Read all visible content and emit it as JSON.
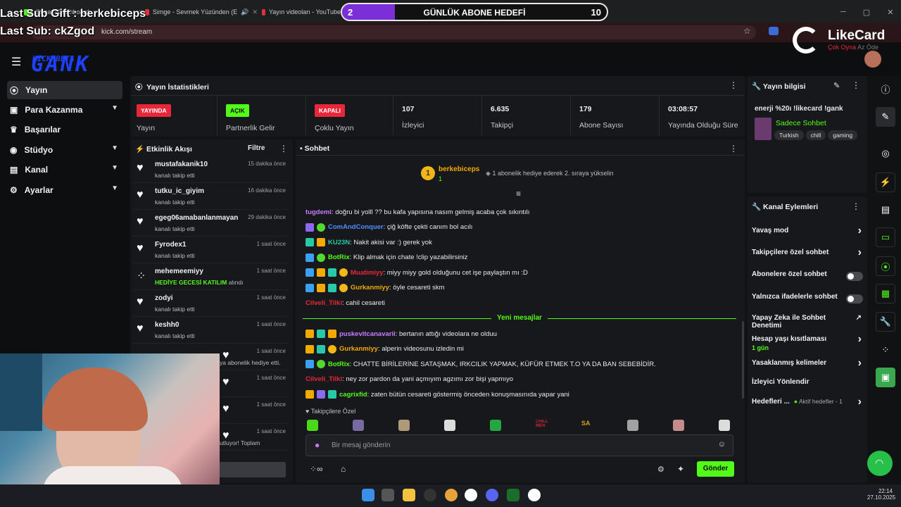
{
  "browser": {
    "tabs": [
      {
        "label": "Stream Dashboard",
        "color": "#53fc18"
      },
      {
        "label": "Simge - Sevmek Yüzünden (E",
        "color": "#e0303a"
      },
      {
        "label": "Yayın videoları - YouTube",
        "color": "#e0303a"
      }
    ],
    "url": "kick.com/stream"
  },
  "overlay": {
    "last_sub_gift": "Last Sub Gift : berkebiceps",
    "last_sub": "Last Sub: ckZgod",
    "goal": {
      "current": "2",
      "title": "GÜNLÜK ABONE HEDEFİ",
      "target": "10",
      "progress": 0.2
    },
    "likecard": {
      "name": "LikeCard",
      "tagline_a": "Çok Oyna",
      "tagline_b": "Az Öde"
    }
  },
  "logo": {
    "text": "GANK",
    "beta": "KICK BETA"
  },
  "sidebar": {
    "items": [
      {
        "label": "Yayın",
        "icon": "broadcast-icon",
        "active": true
      },
      {
        "label": "Para Kazanma",
        "icon": "wallet-icon",
        "chevron": true
      },
      {
        "label": "Başarılar",
        "icon": "trophy-icon"
      },
      {
        "label": "Stüdyo",
        "icon": "studio-icon",
        "chevron": true
      },
      {
        "label": "Kanal",
        "icon": "channel-icon",
        "chevron": true
      },
      {
        "label": "Ayarlar",
        "icon": "settings-icon",
        "chevron": true
      }
    ]
  },
  "stats": {
    "title": "Yayın İstatistikleri",
    "cells": [
      {
        "badge": "YAYINDA",
        "label": "Yayın",
        "badge_color": "#e8283a"
      },
      {
        "badge": "AÇIK",
        "label": "Partnerlik Gelir",
        "badge_color": "#53fc18"
      },
      {
        "badge": "KAPALI",
        "label": "Çoklu Yayın",
        "badge_color": "#e8283a"
      },
      {
        "value": "107",
        "label": "İzleyici"
      },
      {
        "value": "6.635",
        "label": "Takipçi"
      },
      {
        "value": "179",
        "label": "Abone Sayısı"
      },
      {
        "value": "03:08:57",
        "label": "Yayında Olduğu Süre"
      }
    ]
  },
  "activity": {
    "title": "Etkinlik Akışı",
    "filter": "Filtre",
    "items": [
      {
        "name": "mustafakanik10",
        "time": "15 dakika önce",
        "desc": "kanalı takip etti"
      },
      {
        "name": "tutku_ic_giyim",
        "time": "16 dakika önce",
        "desc": "kanalı takip etti"
      },
      {
        "name": "egeg06amabanlanmayan",
        "time": "29 dakika önce",
        "desc": "kanalı takip etti"
      },
      {
        "name": "Fyrodex1",
        "time": "1 saat önce",
        "desc": "kanalı takip etti"
      },
      {
        "name": "mehemeemiyy",
        "time": "1 saat önce",
        "desc_hl": "HEDİYE GECESİ KATILIM",
        "desc": "alındı"
      },
      {
        "name": "zodyi",
        "time": "1 saat önce",
        "desc": "kanalı takip etti"
      },
      {
        "name": "keshh0",
        "time": "1 saat önce",
        "desc": "kanalı takip etti"
      },
      {
        "name": "",
        "time": "1 saat önce",
        "desc": "ya abonelik hediye etti."
      },
      {
        "name": "",
        "time": "1 saat önce",
        "desc": ""
      },
      {
        "name": "",
        "time": "1 saat önce",
        "desc": ""
      },
      {
        "name": "",
        "time": "1 saat önce",
        "desc": "utluyor! Toplam"
      }
    ]
  },
  "chat": {
    "title": "Sohbet",
    "pinned": {
      "rank": "1",
      "user": "berkebiceps",
      "sub": "1",
      "cta": "1 abonelik hediye ederek 2. sıraya yükselin"
    },
    "messages": [
      {
        "user": "tugdemi",
        "color": "#c77dff",
        "text": ": doğru bi yolll ?? bu kafa yapısına nasım gelmiş acaba çok sıkıntılı",
        "icons": []
      },
      {
        "user": "ComAndConquer",
        "color": "#4f8cff",
        "text": ": çiğ köfte çekti canım bol acılı",
        "icons": [
          "p",
          "g"
        ]
      },
      {
        "user": "KU23N",
        "color": "#27c9a8",
        "text": ": Nakit akisi var :) gerek yok",
        "icons": [
          "t",
          "o"
        ]
      },
      {
        "user": "BotRix",
        "color": "#53fc18",
        "text": ": Klip almak için chate !clip yazabilirsiniz",
        "icons": [
          "b",
          "g"
        ]
      },
      {
        "user": "Muatimiyy",
        "color": "#e8283a",
        "text": ": miyy miyy gold olduğunu cet işe paylaştın mı :D",
        "icons": [
          "b",
          "o",
          "t",
          "y"
        ]
      },
      {
        "user": "Gurkanmiyy",
        "color": "#f2a900",
        "text": ": öyle cesareti skm",
        "icons": [
          "b",
          "o",
          "t",
          "y"
        ]
      },
      {
        "user": "Cilveli_Tilki",
        "color": "#e8283a",
        "text": ": cahil cesareti",
        "icons": []
      }
    ],
    "divider": "Yeni mesajlar",
    "new_messages": [
      {
        "user": "puskevitcanavarii",
        "color": "#c77dff",
        "text": ": bertanın attığı videolara ne olduu",
        "icons": [
          "o",
          "t",
          "o"
        ]
      },
      {
        "user": "Gurkanmiyy",
        "color": "#f2a900",
        "text": ": alperin videosunu izledin mi",
        "icons": [
          "o",
          "t",
          "y"
        ]
      },
      {
        "user": "BotRix",
        "color": "#53fc18",
        "text": ": CHATTE BİRİLERİNE SATAŞMAK, IRKCILIK YAPMAK, KÜFÜR ETMEK T.O YA DA BAN SEBEBİDİR.",
        "icons": [
          "b",
          "g"
        ]
      },
      {
        "user": "Cilveli_Tilki",
        "color": "#e8283a",
        "text": ": ney zor pardon da yani açmıyım agzımı zor bişi yapmıyo",
        "icons": []
      },
      {
        "user": "cagrixfid",
        "color": "#53fc18",
        "text": ": zaten bütün cesareti göstermiş önceden konuşmasınıda yapar yani",
        "icons": [
          "o",
          "p",
          "t"
        ]
      }
    ],
    "followers_only": "Takipçilere Özel",
    "emote_labels": {
      "chill": "CHILL MEN",
      "sa": "SA"
    },
    "input_placeholder": "Bir mesaj gönderin",
    "send": "Gönder"
  },
  "stream_info": {
    "title": "Yayın bilgisi",
    "stream_title": "enerji %20ı !likecard !gank",
    "category": "Sadece Sohbet",
    "tags": [
      "Turkish",
      "chill",
      "gaming"
    ]
  },
  "channel_actions": {
    "title": "Kanal Eylemleri",
    "items": [
      {
        "label": "Yavaş mod",
        "type": "chevron"
      },
      {
        "label": "Takipçilere özel sohbet",
        "type": "chevron"
      },
      {
        "label": "Abonelere özel sohbet",
        "type": "toggle"
      },
      {
        "label": "Yalnızca ifadelerle sohbet",
        "type": "toggle"
      },
      {
        "label": "Yapay Zeka ile Sohbet Denetimi",
        "type": "external"
      },
      {
        "label": "Hesap yaşı kısıtlaması",
        "sub": "1 gün",
        "type": "chevron"
      },
      {
        "label": "Yasaklanmış kelimeler",
        "type": "chevron"
      },
      {
        "label": "İzleyici Yönlendir",
        "type": "none"
      },
      {
        "label": "Hedefleri ...",
        "sub_inline": "Aktif hedefler - 1",
        "type": "chevron"
      }
    ]
  },
  "taskbar": {
    "time": "22:14",
    "date": "27.10.2025"
  },
  "colors": {
    "accent": "#53fc18",
    "panel": "#17181b",
    "bg": "#0d0e10"
  }
}
